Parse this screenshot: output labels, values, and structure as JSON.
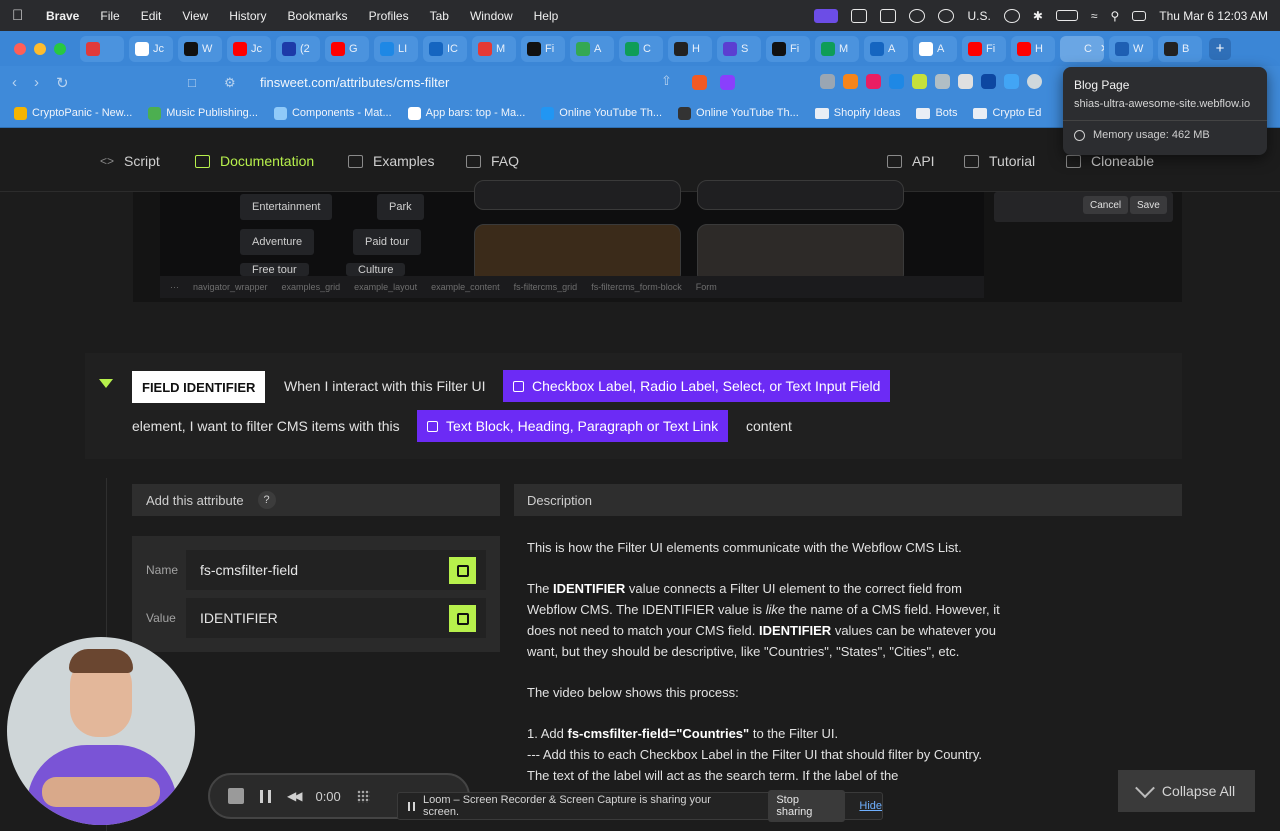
{
  "menubar": {
    "app": "Brave",
    "items": [
      "File",
      "Edit",
      "View",
      "History",
      "Bookmarks",
      "Profiles",
      "Tab",
      "Window",
      "Help"
    ],
    "input_source": "U.S.",
    "datetime": "Thu Mar 6  12:03 AM"
  },
  "tabs": [
    {
      "label": "",
      "color": "#e03a3a"
    },
    {
      "label": "Jc",
      "color": "#ffffff"
    },
    {
      "label": "W",
      "color": "#111111"
    },
    {
      "label": "Jc",
      "color": "#ff0000"
    },
    {
      "label": "(2",
      "color": "#1d3aa8"
    },
    {
      "label": "G",
      "color": "#ff0000"
    },
    {
      "label": "LI",
      "color": "#1e88e5"
    },
    {
      "label": "IC",
      "color": "#1565c0"
    },
    {
      "label": "M",
      "color": "#e53935"
    },
    {
      "label": "Fi",
      "color": "#111111"
    },
    {
      "label": "A",
      "color": "#34a853"
    },
    {
      "label": "C",
      "color": "#0f9d58"
    },
    {
      "label": "H",
      "color": "#222222"
    },
    {
      "label": "S",
      "color": "#5b3fd1"
    },
    {
      "label": "Fi",
      "color": "#111111"
    },
    {
      "label": "M",
      "color": "#0f9d58"
    },
    {
      "label": "A",
      "color": "#1565c0"
    },
    {
      "label": "A",
      "color": "#ffffff"
    },
    {
      "label": "Fi",
      "color": "#ff0000"
    },
    {
      "label": "H",
      "color": "#ff0000"
    },
    {
      "label": "C",
      "color": "#6aa6e4"
    },
    {
      "label": "W",
      "color": "#1e5fb3"
    },
    {
      "label": "B",
      "color": "#222222"
    }
  ],
  "address": {
    "url": "finsweet.com/attributes/cms-filter"
  },
  "bookmarks": [
    {
      "label": "CryptoPanic - New...",
      "kind": "site",
      "color": "#f5b400"
    },
    {
      "label": "Music Publishing...",
      "kind": "site",
      "color": "#4caf50"
    },
    {
      "label": "Components - Mat...",
      "kind": "site",
      "color": "#90caf9"
    },
    {
      "label": "App bars: top - Ma...",
      "kind": "site",
      "color": "#ffffff"
    },
    {
      "label": "Online YouTube Th...",
      "kind": "site",
      "color": "#2196f3"
    },
    {
      "label": "Online YouTube Th...",
      "kind": "site",
      "color": "#333333"
    },
    {
      "label": "Shopify Ideas",
      "kind": "folder",
      "color": "#e9eef5"
    },
    {
      "label": "Bots",
      "kind": "folder",
      "color": "#e9eef5"
    },
    {
      "label": "Crypto Ed",
      "kind": "folder",
      "color": "#e9eef5"
    }
  ],
  "tooltip": {
    "title": "Blog Page",
    "host": "shias-ultra-awesome-site.webflow.io",
    "memory": "Memory usage: 462 MB"
  },
  "sitenav": {
    "left": [
      {
        "label": "Script",
        "icon": "code-icon",
        "active": false
      },
      {
        "label": "Documentation",
        "icon": "list-icon",
        "active": true
      },
      {
        "label": "Examples",
        "icon": "folder-icon",
        "active": false
      },
      {
        "label": "FAQ",
        "icon": "question-icon",
        "active": false
      }
    ],
    "right": [
      {
        "label": "API",
        "icon": "api-icon"
      },
      {
        "label": "Tutorial",
        "icon": "play-icon"
      },
      {
        "label": "Cloneable",
        "icon": "clone-icon"
      }
    ]
  },
  "screenshot": {
    "pills": [
      "Entertainment",
      "Park",
      "Adventure",
      "Paid tour",
      "Free tour",
      "Culture"
    ],
    "crumbs": [
      "navigator_wrapper",
      "examples_grid",
      "example_layout",
      "example_content",
      "fs-filtercms_grid",
      "fs-filtercms_form-block",
      "Form"
    ],
    "cancel": "Cancel",
    "save": "Save"
  },
  "field": {
    "badge": "FIELD IDENTIFIER",
    "text1": "When I interact with this Filter UI",
    "chip1": "Checkbox Label, Radio Label, Select, or Text Input Field",
    "text2": "element, I want to filter CMS items with this",
    "chip2": "Text Block, Heading, Paragraph or Text Link",
    "text3": "content"
  },
  "attribute": {
    "header": "Add this attribute",
    "help": "?",
    "name_label": "Name",
    "name_value": "fs-cmsfilter-field",
    "value_label": "Value",
    "value_value": "IDENTIFIER"
  },
  "description": {
    "header": "Description",
    "p1": "This is how the Filter UI elements communicate with the Webflow CMS List.",
    "p2_a": "The ",
    "p2_b": "IDENTIFIER",
    "p2_c": " value connects a Filter UI element to the correct field from Webflow CMS. The IDENTIFIER value is ",
    "p2_d": "like",
    "p2_e": " the name of a CMS field. However, it does not need to match your CMS field. ",
    "p2_f": "IDENTIFIER",
    "p2_g": " values can be whatever you want, but they should be descriptive, like \"Countries\", \"States\", \"Cities\", etc.",
    "p3": "The video below shows this process:",
    "p4_a": "1. Add ",
    "p4_b": "fs-cmsfilter-field=\"Countries\"",
    "p4_c": " to the Filter UI.",
    "p5": "--- Add this to each Checkbox Label in the Filter UI that should filter by Country. The text of the label will act as the search term. If the label of the"
  },
  "loom": {
    "time": "0:00",
    "share_text": "Loom – Screen Recorder & Screen Capture is sharing your screen.",
    "stop": "Stop sharing",
    "hide": "Hide"
  },
  "collapse": "Collapse All"
}
